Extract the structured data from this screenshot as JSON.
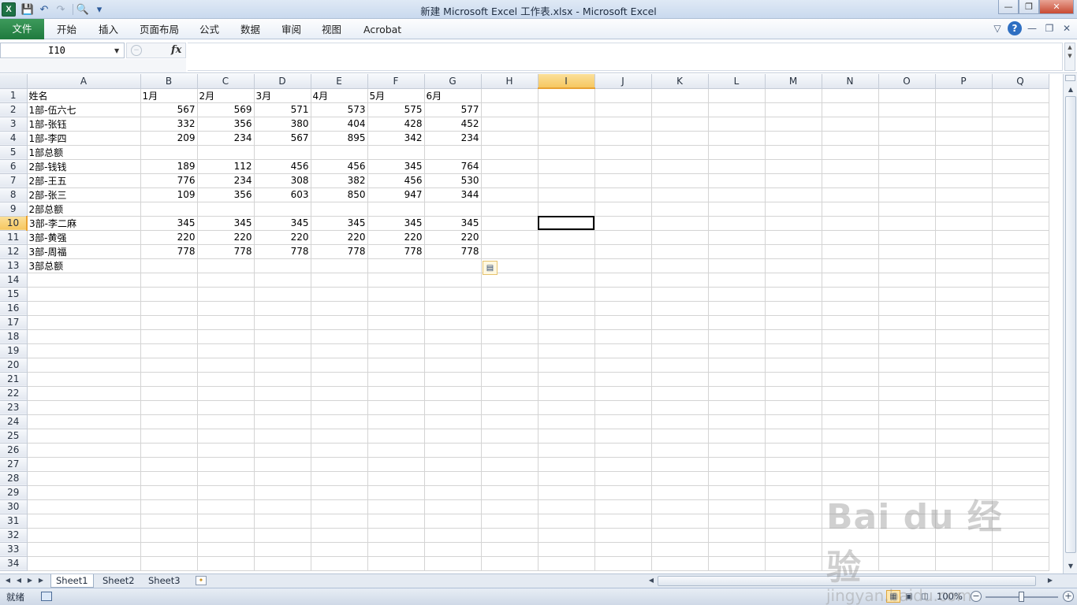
{
  "window": {
    "title": "新建 Microsoft Excel 工作表.xlsx - Microsoft Excel",
    "app_icon": "X",
    "controls": [
      "minimize",
      "restore",
      "close"
    ]
  },
  "quick_access": [
    "save-icon",
    "undo-icon",
    "redo-icon",
    "print-preview-icon",
    "customize-icon"
  ],
  "ribbon": {
    "tabs": [
      "文件",
      "开始",
      "插入",
      "页面布局",
      "公式",
      "数据",
      "审阅",
      "视图",
      "Acrobat"
    ]
  },
  "formula_bar": {
    "name_box": "I10",
    "fx_label": "fx",
    "formula": ""
  },
  "grid": {
    "columns": [
      "A",
      "B",
      "C",
      "D",
      "E",
      "F",
      "G",
      "H",
      "I",
      "J",
      "K",
      "L",
      "M",
      "N",
      "O",
      "P",
      "Q"
    ],
    "active_column": "I",
    "active_row": 10,
    "row_count": 34,
    "rows": [
      [
        "姓名",
        "1月",
        "2月",
        "3月",
        "4月",
        "5月",
        "6月"
      ],
      [
        "1部-伍六七",
        "567",
        "569",
        "571",
        "573",
        "575",
        "577"
      ],
      [
        "1部-张钰",
        "332",
        "356",
        "380",
        "404",
        "428",
        "452"
      ],
      [
        "1部-李四",
        "209",
        "234",
        "567",
        "895",
        "342",
        "234"
      ],
      [
        "1部总额",
        "",
        "",
        "",
        "",
        "",
        ""
      ],
      [
        "2部-钱钱",
        "189",
        "112",
        "456",
        "456",
        "345",
        "764"
      ],
      [
        "2部-王五",
        "776",
        "234",
        "308",
        "382",
        "456",
        "530"
      ],
      [
        "2部-张三",
        "109",
        "356",
        "603",
        "850",
        "947",
        "344"
      ],
      [
        "2部总额",
        "",
        "",
        "",
        "",
        "",
        ""
      ],
      [
        "3部-李二麻",
        "345",
        "345",
        "345",
        "345",
        "345",
        "345"
      ],
      [
        "3部-黄强",
        "220",
        "220",
        "220",
        "220",
        "220",
        "220"
      ],
      [
        "3部-周福",
        "778",
        "778",
        "778",
        "778",
        "778",
        "778"
      ],
      [
        "3部总额",
        "",
        "",
        "",
        "",
        "",
        ""
      ]
    ]
  },
  "sheets": [
    "Sheet1",
    "Sheet2",
    "Sheet3"
  ],
  "active_sheet": "Sheet1",
  "status": {
    "ready": "就绪",
    "zoom": "100%"
  },
  "watermark": {
    "brand": "Bai du 经验",
    "url": "jingyan.baidu.com"
  },
  "colors": {
    "file_tab": "#1f7a3e",
    "active_header": "#f6c760",
    "grid_line": "#d4d4d4"
  }
}
